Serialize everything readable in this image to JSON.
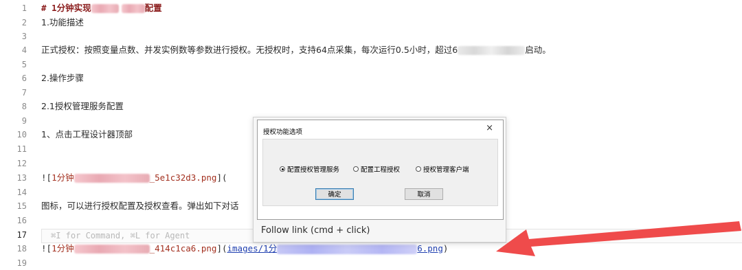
{
  "editor": {
    "active_line": "17",
    "lines": [
      {
        "n": "1",
        "heading": "# 1分钟实现",
        "tail": "配置"
      },
      {
        "n": "2",
        "text": "1.功能描述"
      },
      {
        "n": "3",
        "text": ""
      },
      {
        "n": "4",
        "text": "正式授权：按照变量点数、并发实例数等参数进行授权。无授权时，支持64点采集，每次运行0.5小时，超过6",
        "tail": "启动。"
      },
      {
        "n": "5",
        "text": ""
      },
      {
        "n": "6",
        "text": "2.操作步骤"
      },
      {
        "n": "7",
        "text": ""
      },
      {
        "n": "8",
        "text": "2.1授权管理服务配置"
      },
      {
        "n": "9",
        "text": ""
      },
      {
        "n": "10",
        "text": "1、点击工程设计器顶部"
      },
      {
        "n": "11",
        "text": ""
      },
      {
        "n": "12",
        "text": ""
      },
      {
        "n": "13",
        "prefix": "![",
        "alt": "1分钟",
        "alt_tail": "_5e1c32d3.png",
        "suffix": "]("
      },
      {
        "n": "14",
        "text": ""
      },
      {
        "n": "15",
        "text": "图标，可以进行授权配置及授权查看。弹出如下对话"
      },
      {
        "n": "16",
        "text": ""
      },
      {
        "n": "17",
        "hint": "⌘I for Command, ⌘L for Agent"
      },
      {
        "n": "18",
        "prefix": "![",
        "alt": "1分钟",
        "alt_tail": "_414c1ca6.png",
        "mid": "](",
        "link_start": "images/1分",
        "link_end": "6.png",
        "suffix": ")"
      },
      {
        "n": "19",
        "text": ""
      }
    ]
  },
  "popup": {
    "dialog_title": "授权功能选项",
    "close_glyph": "×",
    "radios": [
      {
        "label": "配置授权管理服务",
        "checked": true
      },
      {
        "label": "配置工程授权",
        "checked": false
      },
      {
        "label": "授权管理客户端",
        "checked": false
      }
    ],
    "ok_label": "确定",
    "cancel_label": "取消",
    "follow_text": "Follow link (cmd + click)"
  },
  "colors": {
    "arrow": "#ef4b4b",
    "heading": "#8b1d1d",
    "link": "#1f3fb0"
  }
}
